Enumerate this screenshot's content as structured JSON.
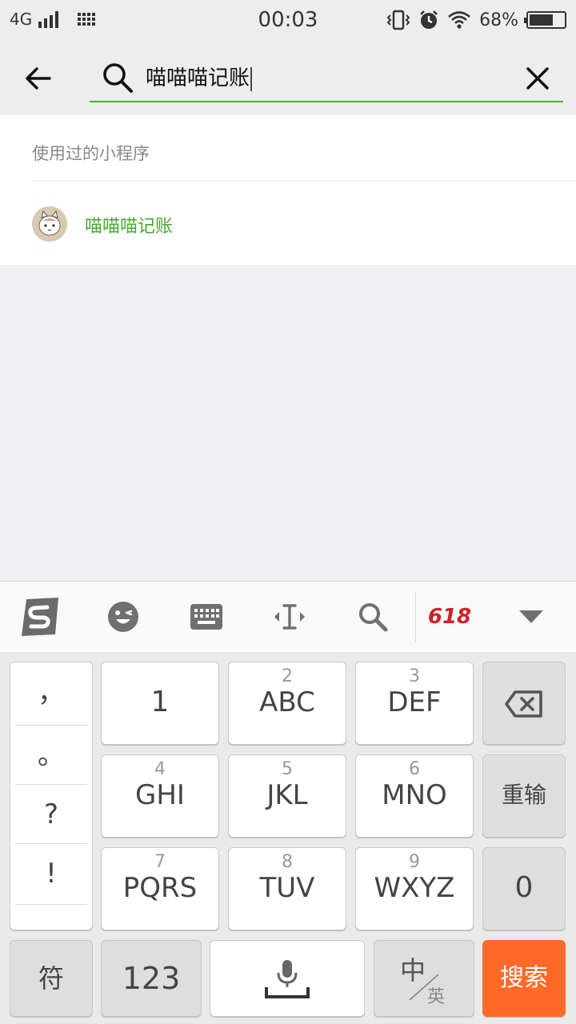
{
  "status_bar": {
    "network": "4G",
    "time": "00:03",
    "battery_percent": "68%",
    "battery_level": 0.68,
    "icons": [
      "signal-icon",
      "grid-app-icon",
      "vibrate-icon",
      "alarm-icon",
      "wifi-icon",
      "battery-icon"
    ]
  },
  "search": {
    "query": "喵喵喵记账",
    "icons": [
      "back-arrow-icon",
      "search-icon",
      "clear-icon"
    ],
    "accent_color": "#4caf30"
  },
  "results": {
    "section_title": "使用过的小程序",
    "items": [
      {
        "name": "喵喵喵记账",
        "avatar_icon": "cat-avatar-icon"
      }
    ],
    "result_color": "#47a930"
  },
  "keyboard": {
    "toolbar": {
      "icons": [
        "sogou-logo-icon",
        "emoji-icon",
        "keyboard-icon",
        "cursor-move-icon",
        "search-icon",
        "618-promo-icon",
        "collapse-triangle-icon"
      ],
      "promo": "618"
    },
    "punctuation": [
      "，",
      "。",
      "?",
      "!"
    ],
    "keys": {
      "k1": {
        "letters": "1"
      },
      "k2": {
        "num": "2",
        "letters": "ABC"
      },
      "k3": {
        "num": "3",
        "letters": "DEF"
      },
      "k4": {
        "num": "4",
        "letters": "GHI"
      },
      "k5": {
        "num": "5",
        "letters": "JKL"
      },
      "k6": {
        "num": "6",
        "letters": "MNO"
      },
      "k7": {
        "num": "7",
        "letters": "PQRS"
      },
      "k8": {
        "num": "8",
        "letters": "TUV"
      },
      "k9": {
        "num": "9",
        "letters": "WXYZ"
      },
      "k0": {
        "letters": "0"
      }
    },
    "reset": "重输",
    "symbols": "符",
    "numbers": "123",
    "lang_main": "中",
    "lang_alt": "英",
    "search": "搜索",
    "search_color": "#ff6a2a"
  }
}
